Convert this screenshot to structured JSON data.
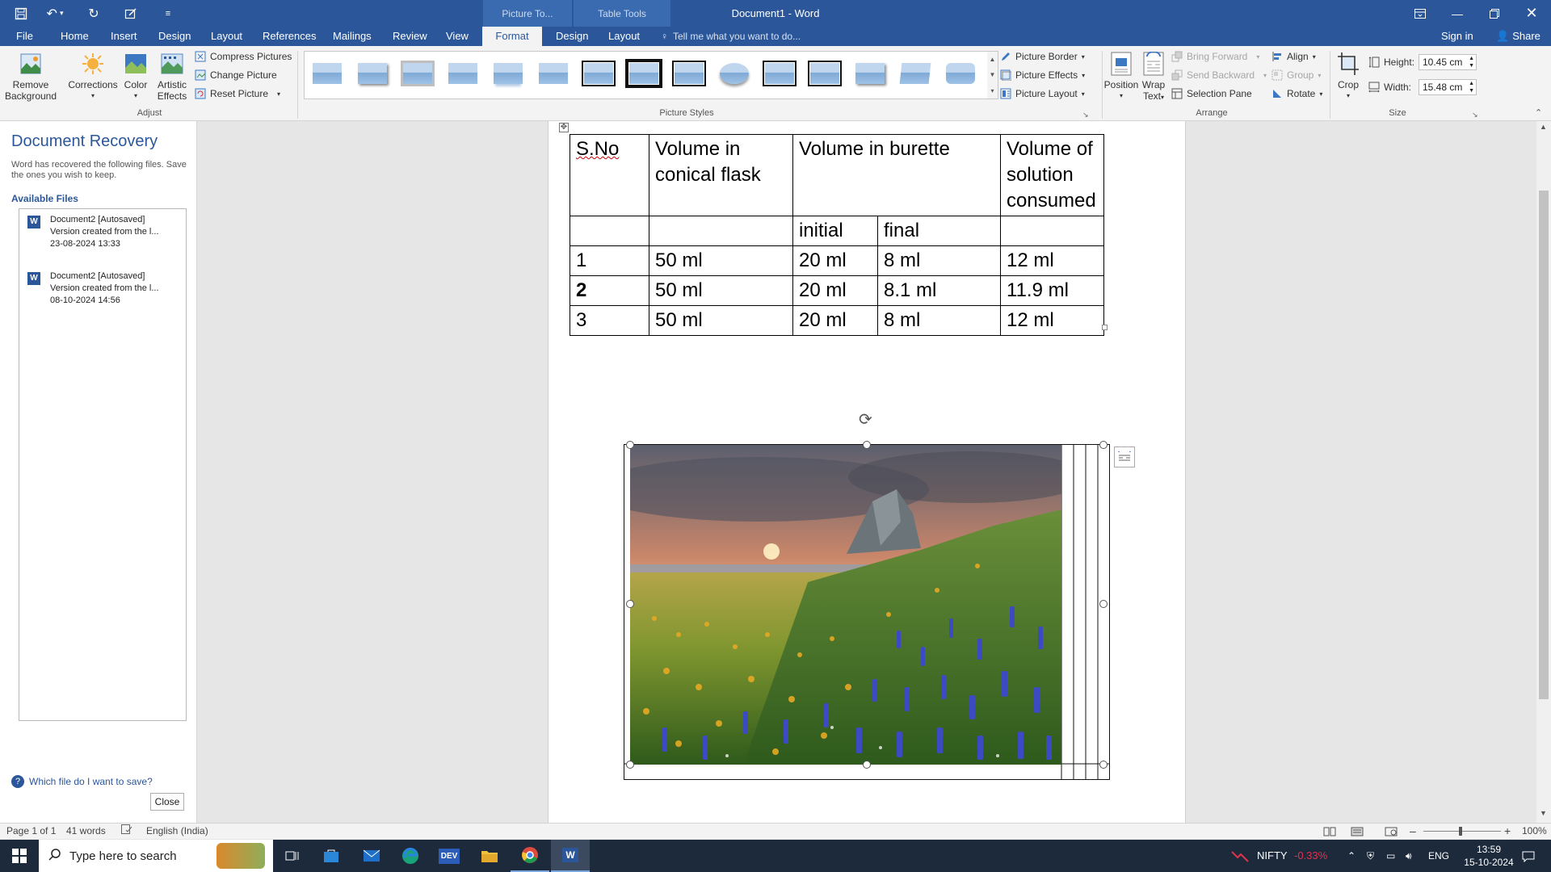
{
  "titlebar": {
    "doc_title": "Document1 - Word",
    "context_groups": [
      "Picture To...",
      "Table Tools"
    ]
  },
  "tabs": [
    "File",
    "Home",
    "Insert",
    "Design",
    "Layout",
    "References",
    "Mailings",
    "Review",
    "View",
    "Format",
    "Design",
    "Layout"
  ],
  "active_tab": "Format",
  "tellme_placeholder": "Tell me what you want to do...",
  "signin": "Sign in",
  "share": "Share",
  "ribbon": {
    "adjust": {
      "remove_bg": [
        "Remove",
        "Background"
      ],
      "corrections": "Corrections",
      "color": "Color",
      "artistic": [
        "Artistic",
        "Effects"
      ],
      "compress": "Compress Pictures",
      "change": "Change Picture",
      "reset": "Reset Picture",
      "label": "Adjust"
    },
    "styles": {
      "label": "Picture Styles",
      "border": "Picture Border",
      "effects": "Picture Effects",
      "layout": "Picture Layout"
    },
    "arrange": {
      "position": "Position",
      "wrap": [
        "Wrap",
        "Text"
      ],
      "bring_forward": "Bring Forward",
      "send_backward": "Send Backward",
      "selection_pane": "Selection Pane",
      "align": "Align",
      "group": "Group",
      "rotate": "Rotate",
      "label": "Arrange"
    },
    "size": {
      "crop": "Crop",
      "height_label": "Height:",
      "height_value": "10.45 cm",
      "width_label": "Width:",
      "width_value": "15.48 cm",
      "label": "Size"
    }
  },
  "recovery": {
    "title": "Document Recovery",
    "desc": "Word has recovered the following files. Save the ones you wish to keep.",
    "available": "Available Files",
    "files": [
      {
        "name": "Document2  [Autosaved]",
        "sub": "Version created from the l...",
        "date": "23-08-2024 13:33"
      },
      {
        "name": "Document2  [Autosaved]",
        "sub": "Version created from the l...",
        "date": "08-10-2024 14:56"
      }
    ],
    "help": "Which file do I want to save?",
    "close": "Close"
  },
  "table": {
    "h1": "S.No",
    "h2": "Volume in conical flask",
    "h3": "Volume in burette",
    "h4": "Volume of solution consumed",
    "sub1": "initial",
    "sub2": "final",
    "rows": [
      [
        "1",
        "50 ml",
        "20 ml",
        "8 ml",
        "12 ml"
      ],
      [
        "2",
        "50 ml",
        "20 ml",
        "8.1 ml",
        "11.9 ml"
      ],
      [
        "3",
        "50 ml",
        "20 ml",
        "8 ml",
        "12 ml"
      ]
    ]
  },
  "status": {
    "page": "Page 1 of 1",
    "words": "41 words",
    "lang": "English (India)",
    "zoom": "100%"
  },
  "taskbar": {
    "search": "Type here to search",
    "nifty": "NIFTY",
    "nifty_change": "-0.33%",
    "lang": "ENG",
    "time": "13:59",
    "date": "15-10-2024"
  },
  "colors": {
    "accent": "#2b579a",
    "negative": "#e0334c"
  }
}
